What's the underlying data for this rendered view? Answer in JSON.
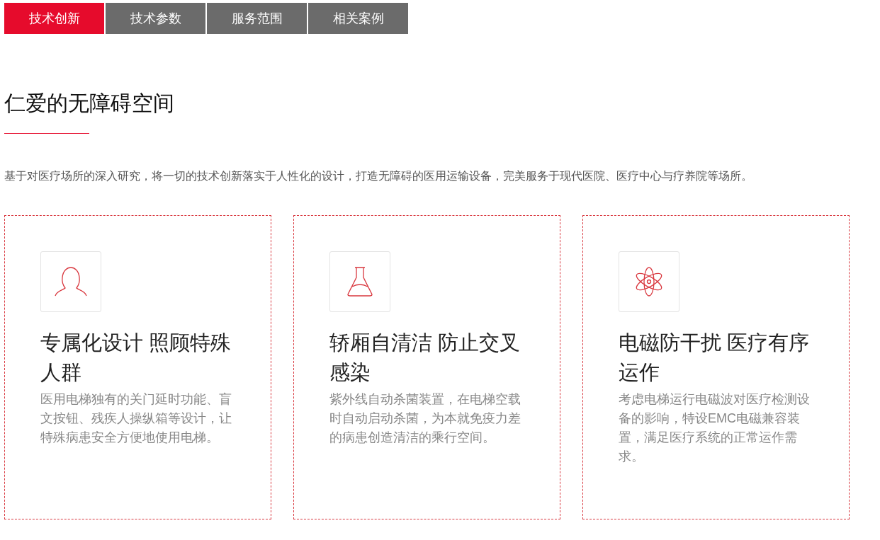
{
  "tabs": [
    {
      "label": "技术创新",
      "selected": true
    },
    {
      "label": "技术参数",
      "selected": false
    },
    {
      "label": "服务范围",
      "selected": false
    },
    {
      "label": "相关案例",
      "selected": false
    }
  ],
  "section": {
    "title": "仁爱的无障碍空间",
    "description": "基于对医疗场所的深入研究，将一切的技术创新落实于人性化的设计，打造无障碍的医用运输设备，完美服务于现代医院、医疗中心与疗养院等场所。"
  },
  "cards": [
    {
      "kind": "person",
      "title": "专属化设计 照顾特殊人群",
      "text": "医用电梯独有的关门延时功能、盲文按钮、残疾人操纵箱等设计，让特殊病患安全方便地使用电梯。"
    },
    {
      "kind": "flask",
      "title": "轿厢自清洁 防止交叉感染",
      "text": "紫外线自动杀菌装置，在电梯空载时自动启动杀菌，为本就免疫力差的病患创造清洁的乘行空间。"
    },
    {
      "kind": "atom",
      "title": "电磁防干扰 医疗有序运作",
      "text": "考虑电梯运行电磁波对医疗检测设备的影响，特设EMC电磁兼容装置，满足医疗系统的正常运作需求。"
    }
  ]
}
